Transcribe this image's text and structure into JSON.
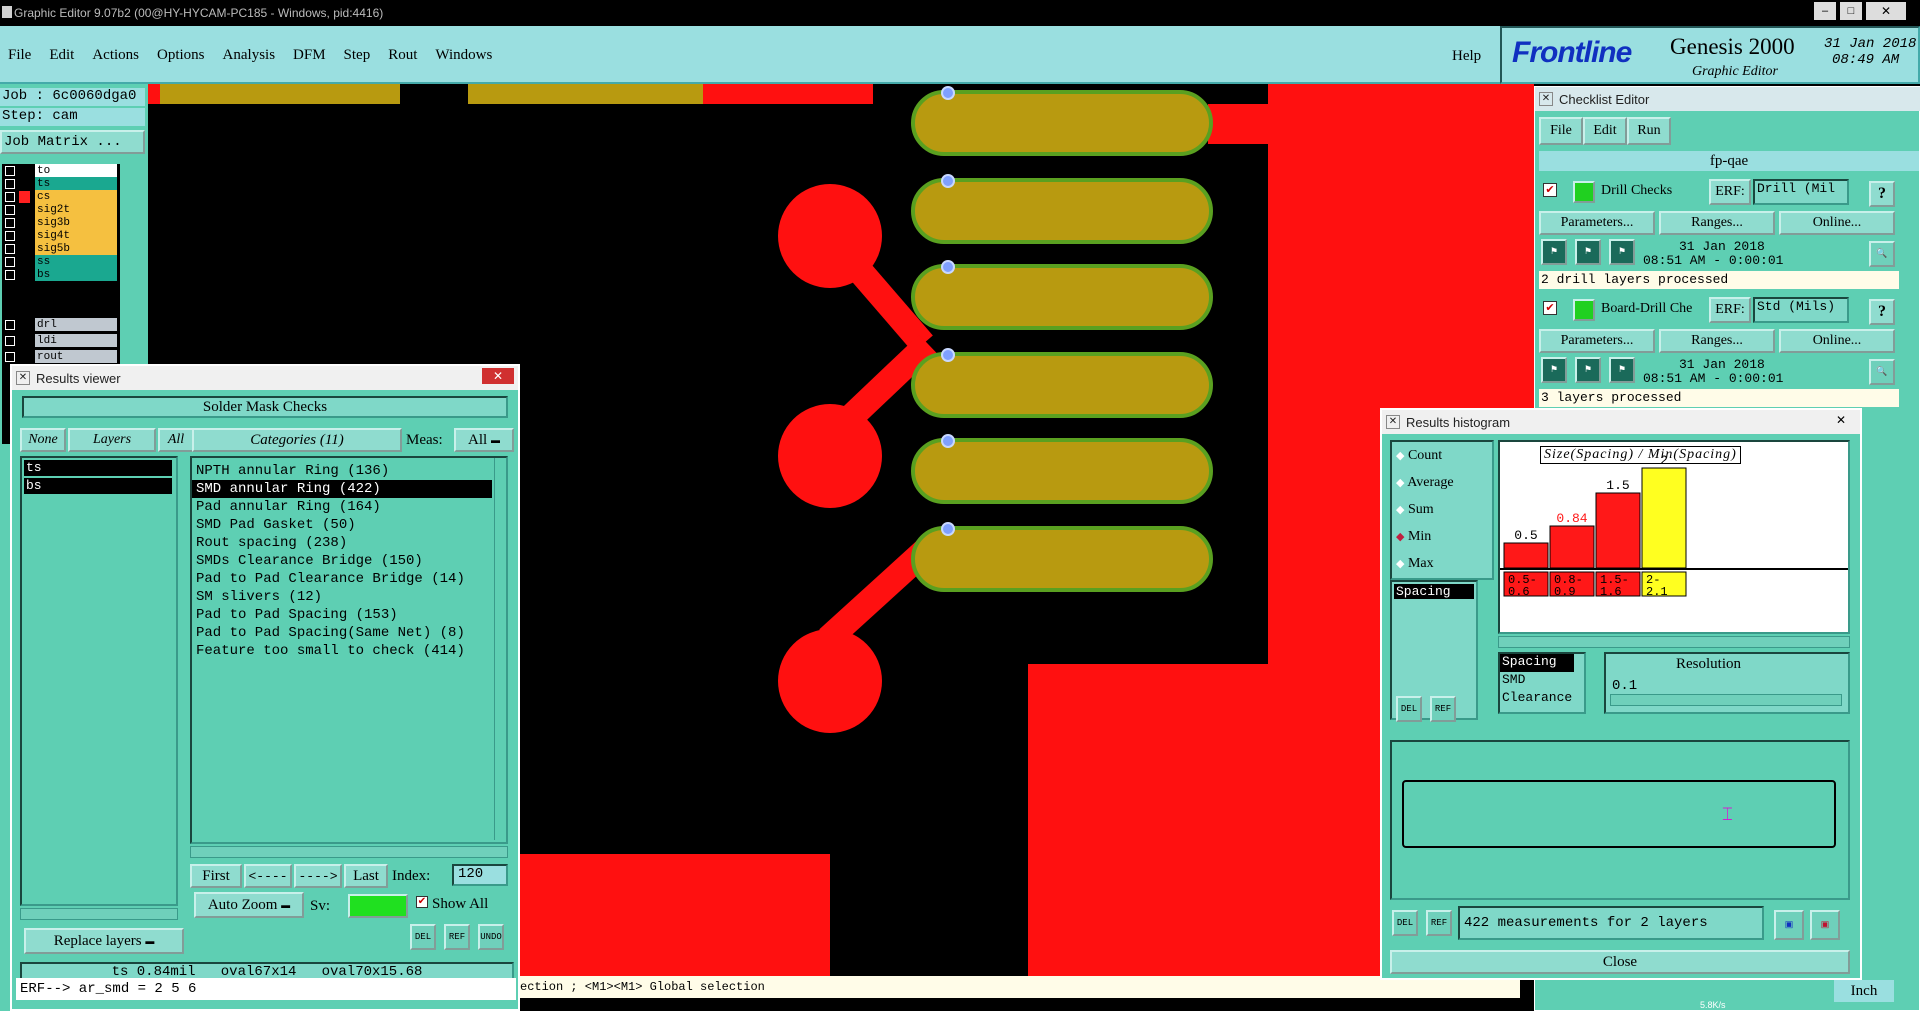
{
  "os_title": "Graphic Editor 9.07b2 (00@HY-HYCAM-PC185 - Windows, pid:4416)",
  "menu": {
    "items": [
      "File",
      "Edit",
      "Actions",
      "Options",
      "Analysis",
      "DFM",
      "Step",
      "Rout",
      "Windows"
    ],
    "help": "Help"
  },
  "brand": {
    "logo": "Frontline",
    "product": "Genesis 2000",
    "subtitle": "Graphic Editor",
    "date": "31 Jan 2018",
    "time": "08:49 AM"
  },
  "job": {
    "job_line": "Job : 6c0060dga0",
    "step_line": "Step: cam",
    "matrix": "Job Matrix ..."
  },
  "layers": [
    {
      "name": "to",
      "color": "#ffffff",
      "sq": "#000000"
    },
    {
      "name": "ts",
      "color": "#1aa890",
      "sq": "#000000"
    },
    {
      "name": "cs",
      "color": "#f5c040",
      "sq": "#ff2020"
    },
    {
      "name": "sig2t",
      "color": "#f5c040",
      "sq": "#000000"
    },
    {
      "name": "sig3b",
      "color": "#f5c040",
      "sq": "#000000"
    },
    {
      "name": "sig4t",
      "color": "#f5c040",
      "sq": "#000000"
    },
    {
      "name": "sig5b",
      "color": "#f5c040",
      "sq": "#000000"
    },
    {
      "name": "ss",
      "color": "#1aa890",
      "sq": "#000000"
    },
    {
      "name": "bs",
      "color": "#1aa890",
      "sq": "#000000"
    },
    {
      "name": "drl",
      "color": "#c0c8d0",
      "sq": "#000000"
    },
    {
      "name": "ldi",
      "color": "#c0c8d0",
      "sq": "#000000"
    },
    {
      "name": "rout",
      "color": "#c0c8d0",
      "sq": "#000000"
    }
  ],
  "results": {
    "title": "Results viewer",
    "heading": "Solder Mask Checks",
    "btn_none": "None",
    "btn_layers": "Layers",
    "btn_all": "All",
    "categories_label": "Categories (11)",
    "meas_label": "Meas:",
    "meas_value": "All",
    "layer_list": [
      "ts",
      "bs"
    ],
    "categories": [
      "NPTH annular Ring (136)",
      "SMD annular Ring (422)",
      "Pad annular Ring (164)",
      "SMD Pad Gasket (50)",
      "Rout spacing (238)",
      "SMDs Clearance Bridge (150)",
      "Pad to Pad Clearance Bridge (14)",
      "SM slivers (12)",
      "Pad to Pad Spacing (153)",
      "Pad to Pad Spacing(Same Net) (8)",
      "Feature too small to check (414)"
    ],
    "nav": {
      "first": "First",
      "prev": "<----",
      "next": "---->",
      "last": "Last",
      "index_label": "Index:",
      "index_value": "120"
    },
    "auto_zoom": "Auto Zoom",
    "sv_label": "Sv:",
    "show_all": "Show All",
    "replace_layers": "Replace layers",
    "icons": {
      "del": "DEL",
      "ref": "REF",
      "undo": "UNDO"
    },
    "status": "ts 0.84mil   oval67x14   oval70x15.68"
  },
  "erf_line": "ERF--> ar_smd = 2 5 6",
  "status_bar": "ection ; <M1><M1> Global selection",
  "checklist": {
    "title": "Checklist Editor",
    "menu": [
      "File",
      "Edit",
      "Run"
    ],
    "name": "fp-qae",
    "blocks": [
      {
        "label": "Drill Checks",
        "erf": "ERF:",
        "erf_value": "Drill (Mil",
        "params": "Parameters...",
        "ranges": "Ranges...",
        "online": "Online...",
        "date": "31 Jan 2018",
        "time": "08:51 AM - 0:00:01",
        "status": "2 drill layers processed"
      },
      {
        "label": "Board-Drill Che",
        "erf": "ERF:",
        "erf_value": "Std (Mils)",
        "params": "Parameters...",
        "ranges": "Ranges...",
        "online": "Online...",
        "date": "31 Jan 2018",
        "time": "08:51 AM - 0:00:01",
        "status": "3 layers processed"
      }
    ],
    "help": "?"
  },
  "histogram": {
    "title": "Results histogram",
    "modes": [
      "Count",
      "Average",
      "Sum",
      "Min",
      "Max"
    ],
    "selected_mode": "Min",
    "list_item": "Spacing",
    "chart_title": "Size(Spacing) / Min(Spacing)",
    "bars": [
      {
        "label": "0.5",
        "range": "0.5-\n0.6",
        "value": 0.5,
        "color": "#ff1818",
        "label_color": "#000000"
      },
      {
        "label": "0.84",
        "range": "0.8-\n0.9",
        "value": 0.84,
        "color": "#ff1818",
        "label_color": "#ff1818"
      },
      {
        "label": "1.5",
        "range": "1.5-\n1.6",
        "value": 1.5,
        "color": "#ff1818",
        "label_color": "#000000"
      },
      {
        "label": "2",
        "range": "2-\n2.1",
        "value": 2,
        "color": "#ffff20",
        "label_color": "#000000"
      }
    ],
    "list2": [
      "Spacing",
      "SMD",
      "Clearance"
    ],
    "resolution_label": "Resolution",
    "resolution_value": "0.1",
    "footer": "422 measurements for 2 layers",
    "close": "Close",
    "icons": {
      "del": "DEL",
      "ref": "REF"
    }
  },
  "inch": "Inch",
  "net_speed": "5.8K/s"
}
